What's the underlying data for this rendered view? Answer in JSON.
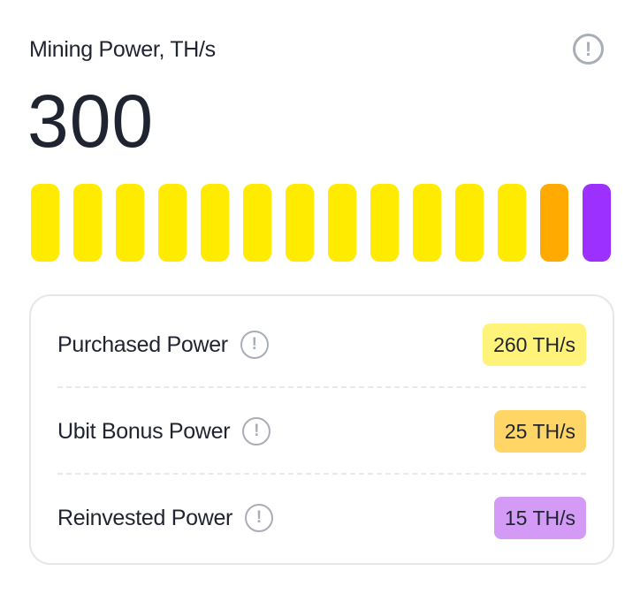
{
  "card": {
    "title": "Mining Power, TH/s",
    "total_value": "300",
    "info_icon": "info-exclamation-icon"
  },
  "power_bar": {
    "segments": [
      {
        "type": "purchased",
        "color": "#FFEB00"
      },
      {
        "type": "purchased",
        "color": "#FFEB00"
      },
      {
        "type": "purchased",
        "color": "#FFEB00"
      },
      {
        "type": "purchased",
        "color": "#FFEB00"
      },
      {
        "type": "purchased",
        "color": "#FFEB00"
      },
      {
        "type": "purchased",
        "color": "#FFEB00"
      },
      {
        "type": "purchased",
        "color": "#FFEB00"
      },
      {
        "type": "purchased",
        "color": "#FFEB00"
      },
      {
        "type": "purchased",
        "color": "#FFEB00"
      },
      {
        "type": "purchased",
        "color": "#FFEB00"
      },
      {
        "type": "purchased",
        "color": "#FFEB00"
      },
      {
        "type": "purchased",
        "color": "#FFEB00"
      },
      {
        "type": "bonus",
        "color": "#FFAA00"
      },
      {
        "type": "reinvested",
        "color": "#9B30FF"
      }
    ]
  },
  "breakdown": {
    "rows": [
      {
        "label": "Purchased Power",
        "value": "260 TH/s",
        "pill_color": "#FFF37A"
      },
      {
        "label": "Ubit Bonus Power",
        "value": "25 TH/s",
        "pill_color": "#FFD666"
      },
      {
        "label": "Reinvested Power",
        "value": "15 TH/s",
        "pill_color": "#D39BF5"
      }
    ]
  },
  "colors": {
    "text": "#1F2430",
    "icon_gray": "#A9ADB5",
    "border": "#E6E7EA"
  }
}
